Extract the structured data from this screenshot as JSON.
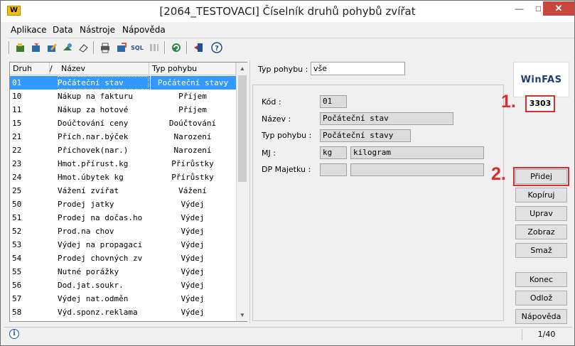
{
  "window": {
    "title": "[2064_TESTOVACI] Číselník druhů pohybů zvířat",
    "app_logo": "W"
  },
  "menu": [
    "Aplikace",
    "Data",
    "Nástroje",
    "Nápověda"
  ],
  "toolbar": {
    "sql_label": "SQL"
  },
  "grid": {
    "columns": [
      "Druh",
      "/",
      "Název",
      "Typ pohybu"
    ],
    "rows": [
      [
        "01",
        "Počáteční stav",
        "Počáteční stavy"
      ],
      [
        "10",
        "Nákup na fakturu",
        "Příjem"
      ],
      [
        "11",
        "Nákup za hotové",
        "Příjem"
      ],
      [
        "15",
        "Doúčtování ceny",
        "Doúčtování"
      ],
      [
        "21",
        "Přích.nar.býček",
        "Narození"
      ],
      [
        "22",
        "Příchovek(nar.)",
        "Narození"
      ],
      [
        "23",
        "Hmot.přírust.kg",
        "Přírůstky"
      ],
      [
        "24",
        "Hmot.úbytek kg",
        "Přírůstky"
      ],
      [
        "25",
        "Vážení zvířat",
        "Vážení"
      ],
      [
        "50",
        "Prodej jatky",
        "Výdej"
      ],
      [
        "51",
        "Prodej na dočas.ho",
        "Výdej"
      ],
      [
        "52",
        "Prod.na chov",
        "Výdej"
      ],
      [
        "53",
        "Výdej na propagaci",
        "Výdej"
      ],
      [
        "54",
        "Prodej chovných zv",
        "Výdej"
      ],
      [
        "55",
        "Nutné porážky",
        "Výdej"
      ],
      [
        "56",
        "Dod.jat.soukr.",
        "Výdej"
      ],
      [
        "57",
        "Výdej nat.odměn",
        "Výdej"
      ],
      [
        "58",
        "Výd.sponz.reklama",
        "Výdej"
      ]
    ]
  },
  "filter": {
    "label": "Typ pohybu :",
    "value": "vše"
  },
  "detail": {
    "kod_label": "Kód   :",
    "kod_value": "01",
    "nazev_label": "Název :",
    "nazev_value": "Počáteční stav",
    "typ_label": "Typ pohybu :",
    "typ_value": "Počáteční stavy",
    "mj_label": "MJ :",
    "mj_code": "kg",
    "mj_name": "kilogram",
    "dp_label": "DP Majetku :",
    "dp_code": "",
    "dp_name": ""
  },
  "right": {
    "logo_text": "WinFAS",
    "number": "3303",
    "annot1": "1.",
    "annot2": "2.",
    "buttons": [
      "Přidej",
      "Kopíruj",
      "Uprav",
      "Zobraz",
      "Smaž",
      "Konec",
      "Odlož",
      "Nápověda"
    ]
  },
  "status": {
    "page": "1/40",
    "info_icon": "i"
  }
}
